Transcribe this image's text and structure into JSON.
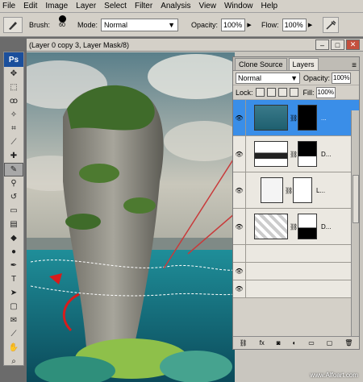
{
  "menu": [
    "File",
    "Edit",
    "Image",
    "Layer",
    "Select",
    "Filter",
    "Analysis",
    "View",
    "Window",
    "Help"
  ],
  "options": {
    "brush_label": "Brush:",
    "brush_size": "60",
    "mode_label": "Mode:",
    "mode_value": "Normal",
    "opacity_label": "Opacity:",
    "opacity_value": "100%",
    "flow_label": "Flow:",
    "flow_value": "100%"
  },
  "toolbox": {
    "logo": "Ps"
  },
  "document": {
    "title": "(Layer 0 copy 3, Layer Mask/8)"
  },
  "panel": {
    "tabs": [
      "Clone Source",
      "Layers"
    ],
    "blend_mode": "Normal",
    "opacity_label": "Opacity:",
    "opacity_value": "100%",
    "lock_label": "Lock:",
    "fill_label": "Fill:",
    "fill_value": "100%",
    "layers": [
      {
        "name": "...",
        "selected": true
      },
      {
        "name": "D...",
        "selected": false
      },
      {
        "name": "L...",
        "selected": false
      },
      {
        "name": "D...",
        "selected": false
      }
    ],
    "footer_icons": [
      "link-icon",
      "fx-icon",
      "mask-icon",
      "adjustment-icon",
      "folder-icon",
      "new-layer-icon",
      "trash-icon"
    ]
  },
  "watermark": "www.Alfoart.com"
}
